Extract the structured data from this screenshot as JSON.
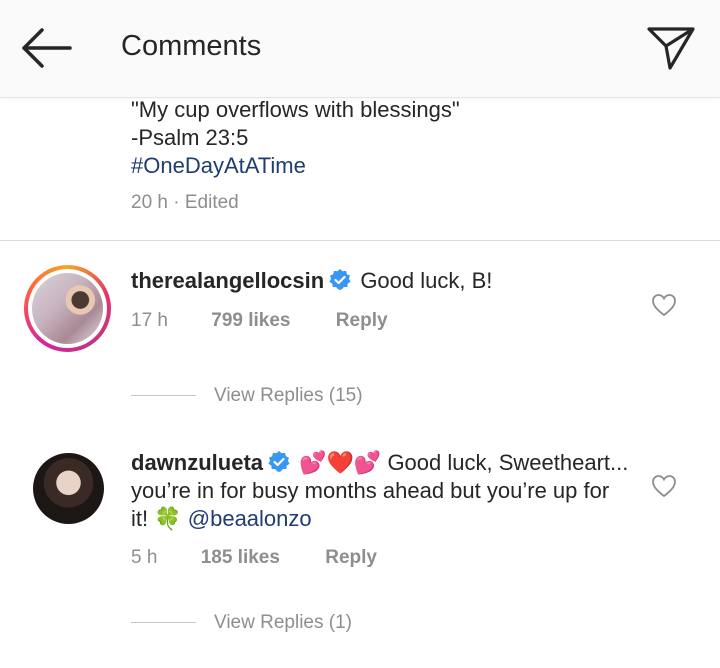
{
  "header": {
    "title": "Comments",
    "back_icon": "arrow-left-icon",
    "share_icon": "paper-plane-icon"
  },
  "caption": {
    "quote": "\"My cup overflows with blessings\"",
    "reference": "-Psalm 23:5",
    "hashtag": "#OneDayAtATime",
    "time": "20 h",
    "separator": "·",
    "edited": "Edited"
  },
  "comments": [
    {
      "username": "therealangellocsin",
      "verified": true,
      "text": "Good luck, B!",
      "time": "17 h",
      "likes": "799 likes",
      "reply": "Reply",
      "view_replies": "View Replies (15)"
    },
    {
      "username": "dawnzulueta",
      "verified": true,
      "emojis": "💕❤️💕",
      "text": " Good luck, Sweetheart... you’re in for busy months ahead but you’re up for it! ",
      "clover": "🍀",
      "mention": "@beaalonzo",
      "time": "5 h",
      "likes": "185 likes",
      "reply": "Reply",
      "view_replies": "View Replies (1)"
    }
  ],
  "colors": {
    "link": "#1f3d73",
    "secondary": "#8e8e8e",
    "verified": "#3897f0"
  }
}
